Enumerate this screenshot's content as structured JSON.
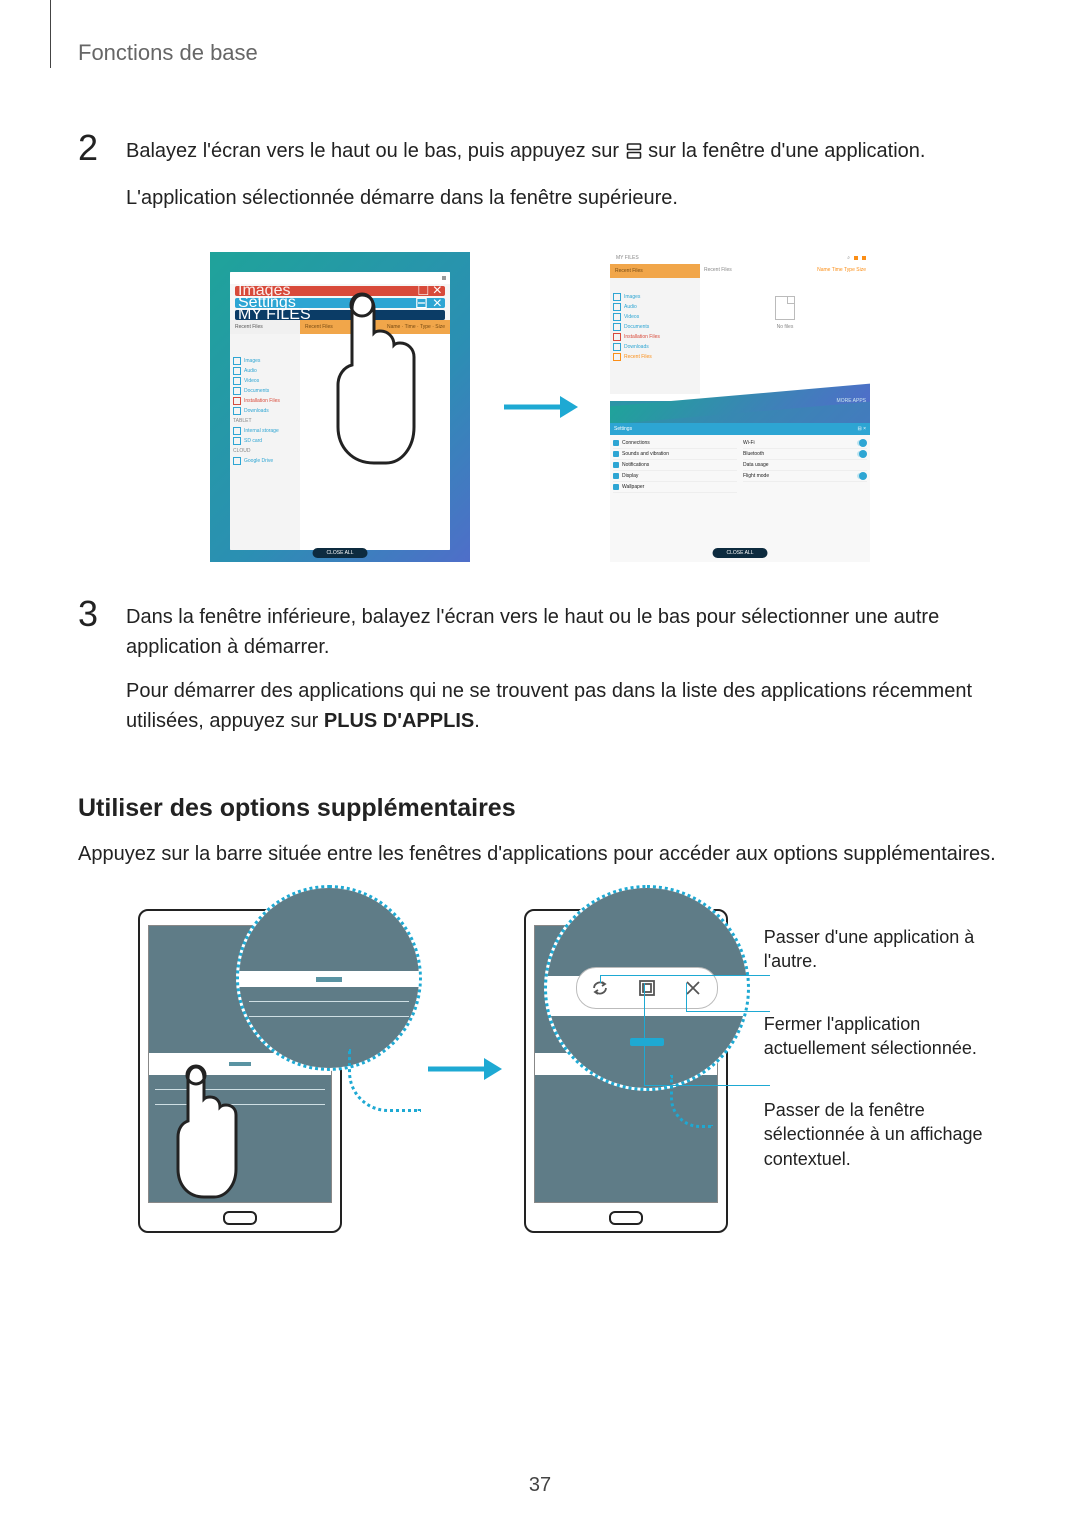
{
  "header": {
    "title": "Fonctions de base"
  },
  "step2": {
    "num": "2",
    "p1_a": "Balayez l'écran vers le haut ou le bas, puis appuyez sur ",
    "p1_b": " sur la fenêtre d'une application.",
    "p2": "L'application sélectionnée démarre dans la fenêtre supérieure."
  },
  "step3": {
    "num": "3",
    "p1": "Dans la fenêtre inférieure, balayez l'écran vers le haut ou le bas pour sélectionner une autre application à démarrer.",
    "p2_a": "Pour démarrer des applications qui ne se trouvent pas dans la liste des applications récemment utilisées, appuyez sur ",
    "p2_bold": "PLUS D'APPLIS",
    "p2_b": "."
  },
  "subhead": "Utiliser des options supplémentaires",
  "subhead_body": "Appuyez sur la barre située entre les fenêtres d'applications pour accéder aux options supplémentaires.",
  "callouts": {
    "swap": "Passer d'une application à l'autre.",
    "close": "Fermer l'application actuellement sélectionnée.",
    "popup": "Passer de la fenêtre sélectionnée à un affichage contextuel."
  },
  "mock": {
    "my_files": "MY FILES",
    "recent_files": "Recent Files",
    "images": "Images",
    "audio": "Audio",
    "videos": "Videos",
    "documents": "Documents",
    "installation_files": "Installation Files",
    "downloads": "Downloads",
    "tablet": "TABLET",
    "internal_storage": "Internal storage",
    "sd_card": "SD card",
    "cloud": "CLOUD",
    "google_drive": "Google Drive",
    "no_files": "No files",
    "name": "Name",
    "time": "Time",
    "type": "Type",
    "size": "Size",
    "close_all": "CLOSE ALL",
    "more_apps": "MORE APPS",
    "settings": "Settings",
    "connections": "Connections",
    "sounds_vib": "Sounds and vibration",
    "notifications": "Notifications",
    "display": "Display",
    "wallpaper": "Wallpaper",
    "wifi": "Wi-Fi",
    "bluetooth": "Bluetooth",
    "data_usage": "Data usage",
    "flight_mode": "Flight mode"
  },
  "page_number": "37"
}
